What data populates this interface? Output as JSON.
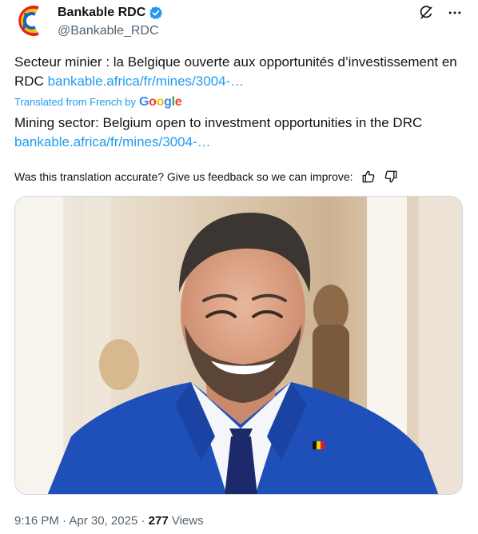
{
  "author": {
    "name": "Bankable RDC",
    "handle": "@Bankable_RDC",
    "verified": true
  },
  "header_icons": [
    "grok-icon",
    "more-icon"
  ],
  "post": {
    "original_text": "Secteur minier : la Belgique ouverte aux opportunités d’investissement en RDC",
    "original_link": "bankable.africa/fr/mines/3004-…",
    "translated_label": "Translated from French by",
    "translator_logo": [
      "G",
      "o",
      "o",
      "g",
      "l",
      "e"
    ],
    "translated_text": "Mining sector: Belgium open to investment opportunities in the DRC",
    "translated_link": "bankable.africa/fr/mines/3004-…",
    "feedback_prompt": "Was this translation accurate? Give us feedback so we can improve:"
  },
  "colors": {
    "link": "#1d9bf0",
    "secondary_text": "#536471",
    "jacket": "#1f4fb8"
  },
  "footer": {
    "time": "9:16 PM",
    "separator": "·",
    "date": "Apr 30, 2025",
    "views_count": "277",
    "views_label": "Views"
  }
}
